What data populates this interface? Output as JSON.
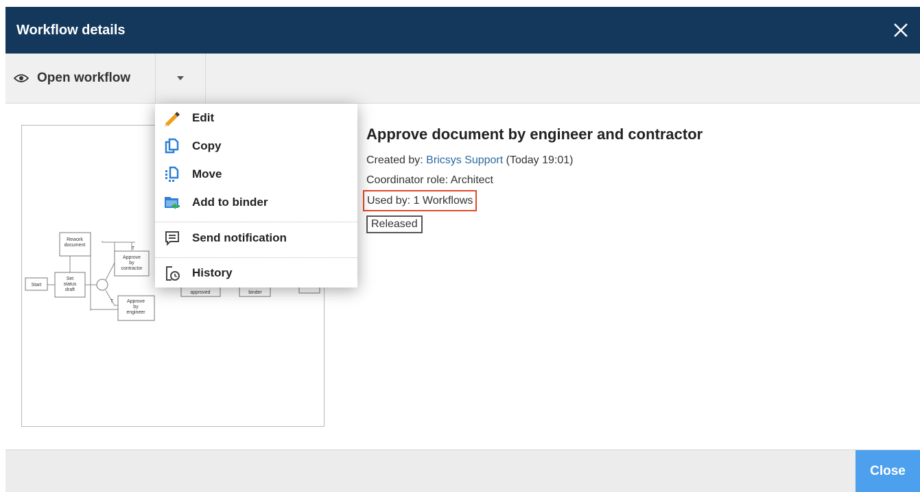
{
  "dialog": {
    "title": "Workflow details"
  },
  "toolbar": {
    "open_label": "Open workflow"
  },
  "menu": {
    "edit": "Edit",
    "copy": "Copy",
    "move": "Move",
    "add_to_binder": "Add to binder",
    "send_notification": "Send notification",
    "history": "History"
  },
  "preview": {
    "start": "Start",
    "set_status_1": "Set",
    "set_status_2": "status",
    "set_status_3": "draft",
    "rework_1": "Rework",
    "rework_2": "document",
    "contractor_1": "Approve",
    "contractor_2": "by",
    "contractor_3": "contractor",
    "engineer_1": "Approve",
    "engineer_2": "by",
    "engineer_3": "engineer",
    "approved": "approved",
    "binder": "binder",
    "edge_true": "T"
  },
  "workflow": {
    "title": "Approve document by engineer and contractor",
    "created_prefix": "Created by: ",
    "created_by": "Bricsys Support",
    "created_time": " (Today 19:01)",
    "coordinator": "Coordinator role: Architect",
    "used_by": "Used by: 1 Workflows",
    "status": "Released"
  },
  "footer": {
    "close_label": "Close"
  },
  "colors": {
    "header": "#13385c",
    "link": "#2c6aa0",
    "highlight": "#e0482a",
    "primary_button": "#4da0ee"
  }
}
